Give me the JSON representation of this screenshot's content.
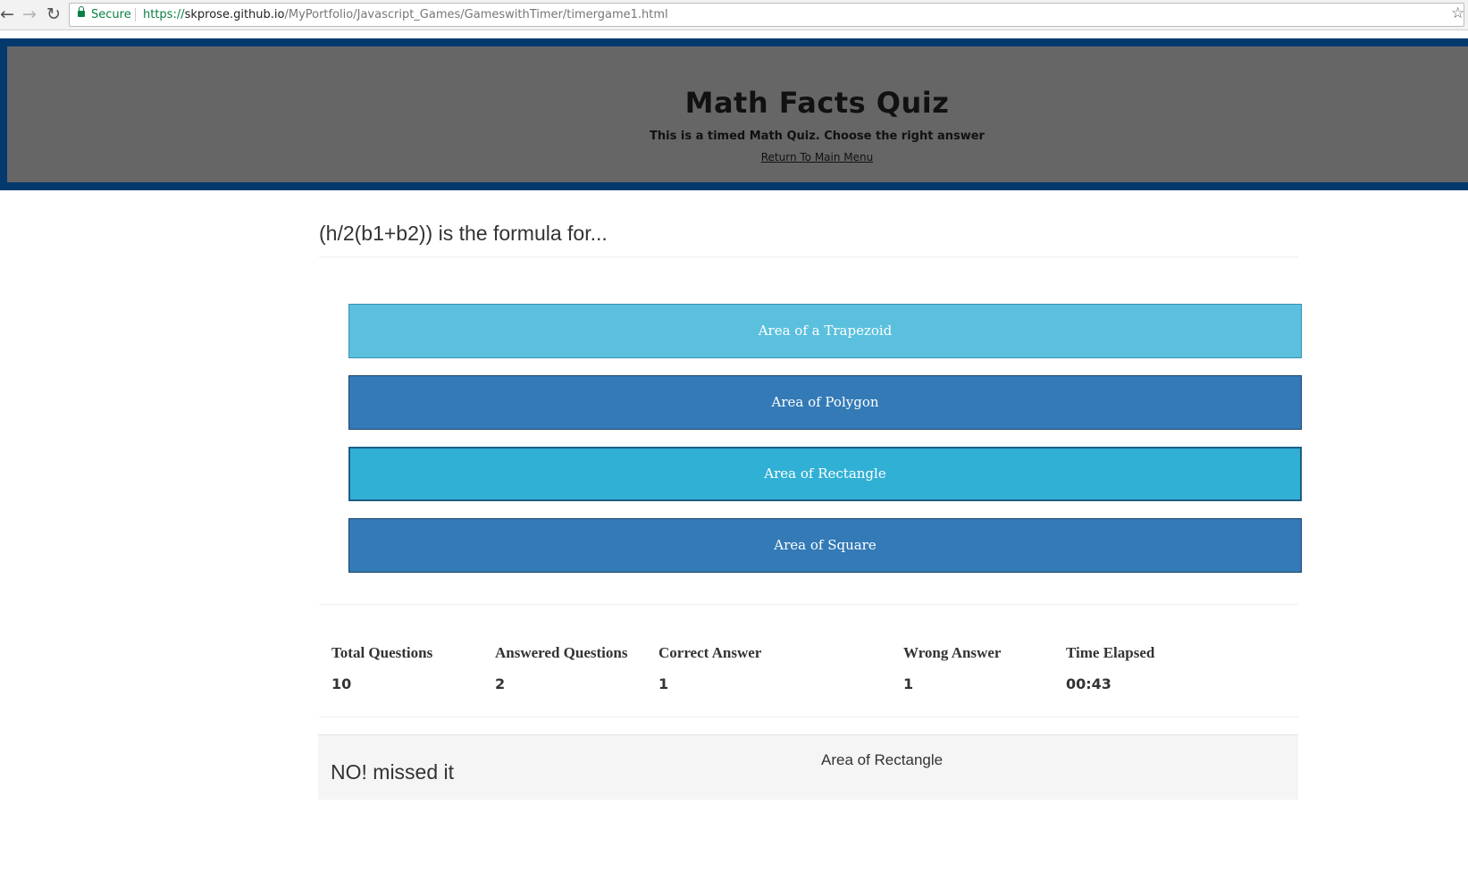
{
  "browser": {
    "secure_label": "Secure",
    "url_scheme": "https://",
    "url_host": "skprose.github.io",
    "url_path": "/MyPortfolio/Javascript_Games/GameswithTimer/timergame1.html",
    "back_icon": "arrow-left-icon",
    "forward_icon": "arrow-right-icon",
    "reload_icon": "reload-icon",
    "bookmark_icon": "star-icon"
  },
  "header": {
    "title": "Math Facts Quiz",
    "subtitle": "This is a timed Math Quiz. Choose the right answer",
    "menu_link": "Return To Main Menu",
    "border_color": "#04396e",
    "background_color": "#666666"
  },
  "question": {
    "text": "(h/2(b1+b2)) is the formula for..."
  },
  "answers": [
    {
      "label": "Area of a Trapezoid",
      "color": "#5bc0de"
    },
    {
      "label": "Area of Polygon",
      "color": "#337ab7"
    },
    {
      "label": "Area of Rectangle",
      "color": "#31b0d5",
      "selected": true
    },
    {
      "label": "Area of Square",
      "color": "#337ab7"
    }
  ],
  "stats": {
    "total_label": "Total Questions",
    "total_value": "10",
    "answered_label": "Answered Questions",
    "answered_value": "2",
    "correct_label": "Correct Answer",
    "correct_value": "1",
    "wrong_label": "Wrong Answer",
    "wrong_value": "1",
    "time_label": "Time Elapsed",
    "time_value": "00:43"
  },
  "feedback": {
    "message": "NO! missed it",
    "selected_answer": "Area of Rectangle"
  }
}
